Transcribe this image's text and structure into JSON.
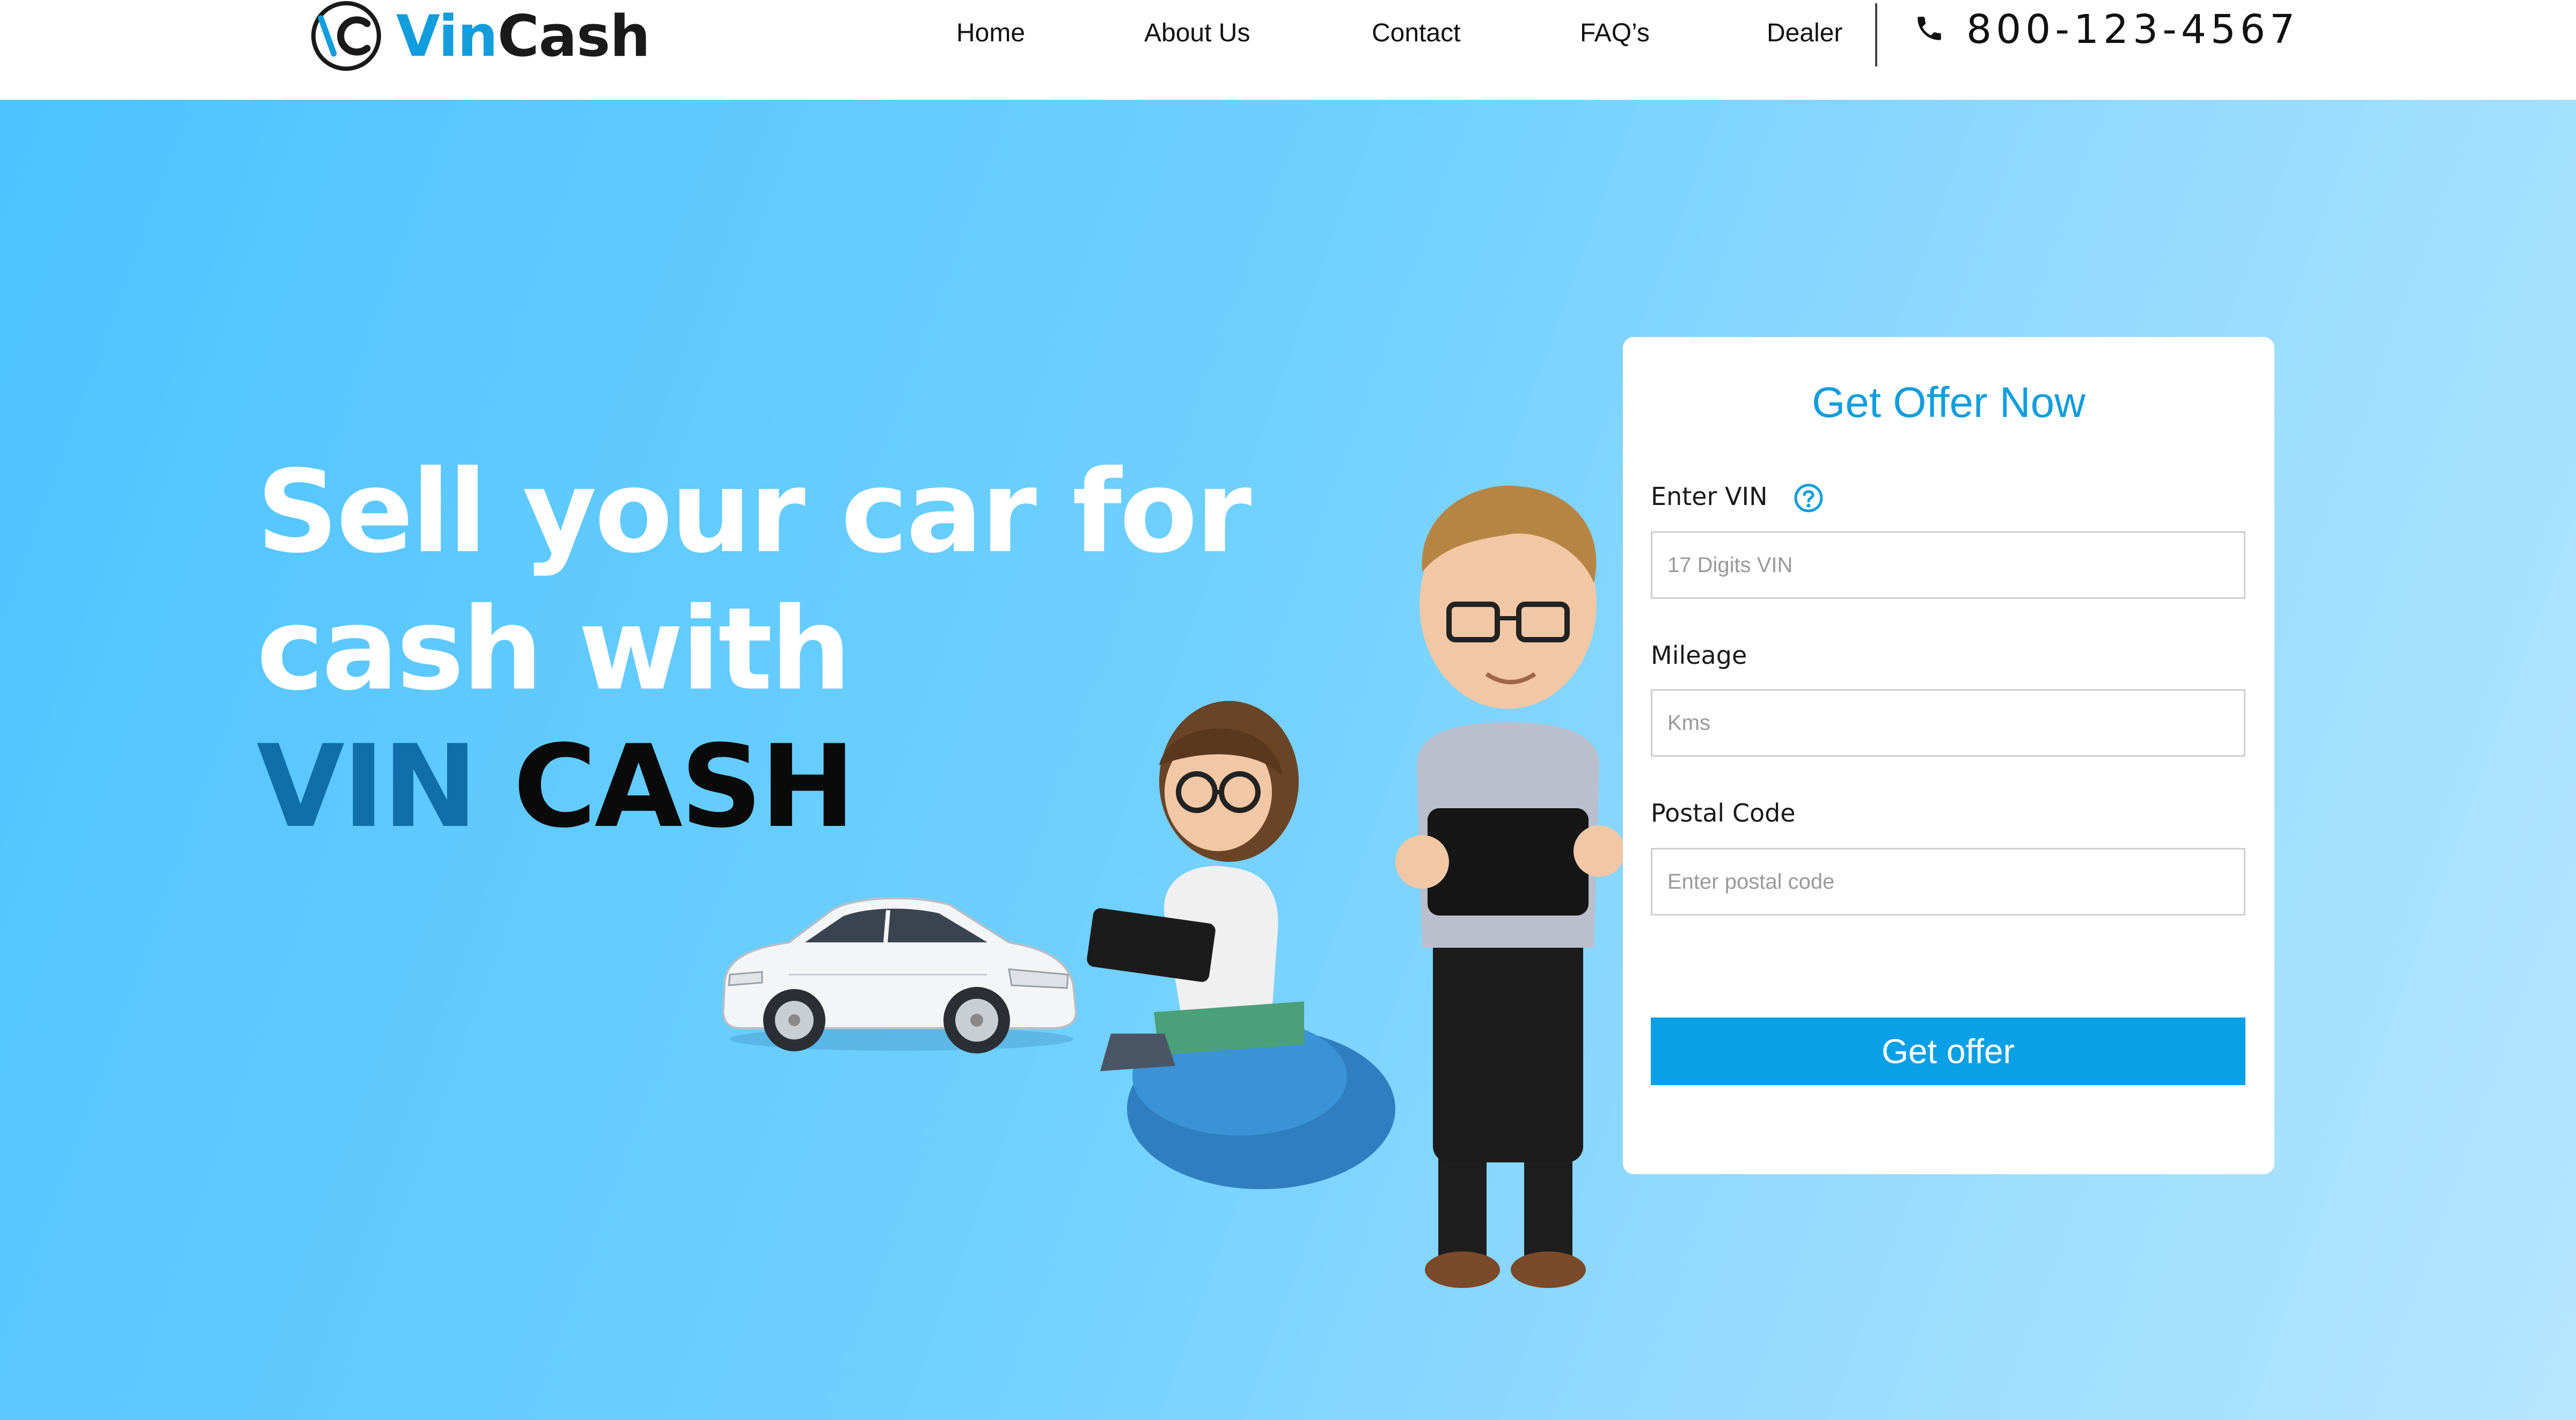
{
  "brand": {
    "name_part1": "Vin",
    "name_part2": "Cash",
    "logo_monogram": "VC"
  },
  "nav": {
    "items": [
      {
        "label": "Home"
      },
      {
        "label": "About Us"
      },
      {
        "label": "Contact"
      },
      {
        "label": "FAQ’s"
      },
      {
        "label": "Dealer"
      }
    ],
    "phone": {
      "icon": "phone-icon",
      "number": "800-123-4567"
    }
  },
  "hero": {
    "headline_line1": "Sell your car for",
    "headline_line2": "cash with",
    "headline_vin": "VIN",
    "headline_cash": "CASH"
  },
  "form": {
    "title": "Get Offer Now",
    "vin": {
      "label": "Enter VIN",
      "placeholder": "17 Digits VIN",
      "value": "",
      "help_icon": "question-circle-icon"
    },
    "mileage": {
      "label": "Mileage",
      "placeholder": "Kms",
      "value": ""
    },
    "postal": {
      "label": "Postal Code",
      "placeholder": "Enter postal code",
      "value": ""
    },
    "submit_label": "Get offer"
  },
  "colors": {
    "brand_blue": "#129ddd",
    "button_blue": "#0aa0e6",
    "headline_vin": "#0f6fa8",
    "hero_gradient_start": "#4ec3ff",
    "hero_gradient_end": "#b5e6ff"
  }
}
